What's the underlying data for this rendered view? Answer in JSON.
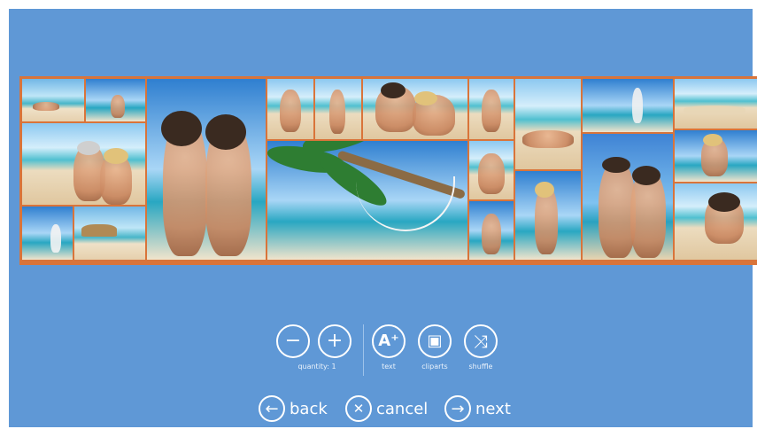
{
  "toolbar": {
    "decrease_icon": "minus-icon",
    "increase_icon": "plus-icon",
    "quantity_label": "quantity: 1",
    "text_label": "text",
    "cliparts_label": "cliparts",
    "shuffle_label": "shuffle",
    "text_icon_glyph": "A⁺",
    "decrease_glyph": "−",
    "increase_glyph": "+",
    "cliparts_glyph": "▣",
    "shuffle_glyph": "⤨"
  },
  "nav": {
    "back_label": "back",
    "cancel_label": "cancel",
    "next_label": "next",
    "back_glyph": "←",
    "cancel_glyph": "✕",
    "next_glyph": "→"
  },
  "colors": {
    "background": "#5f98d6",
    "collage_border": "#d9743a",
    "icon_stroke": "#ffffff"
  }
}
